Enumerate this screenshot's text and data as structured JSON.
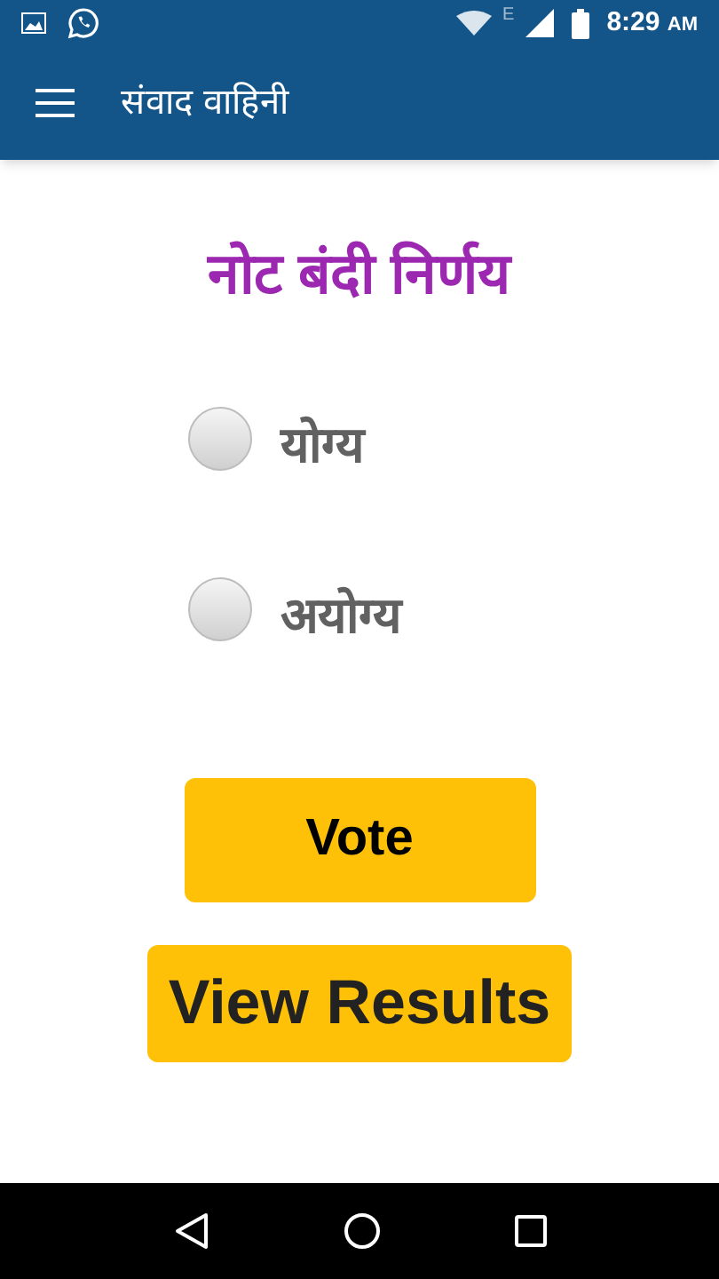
{
  "status_bar": {
    "network_type": "E",
    "time": "8:29",
    "meridiem": "AM"
  },
  "app_bar": {
    "title": "संवाद वाहिनी"
  },
  "poll": {
    "question": "नोट बंदी निर्णय",
    "options": [
      {
        "label": "योग्य",
        "selected": false
      },
      {
        "label": "अयोग्य",
        "selected": false
      }
    ]
  },
  "buttons": [
    {
      "label": "Vote",
      "kind": "vote"
    },
    {
      "label": "View Results",
      "kind": "results"
    }
  ]
}
